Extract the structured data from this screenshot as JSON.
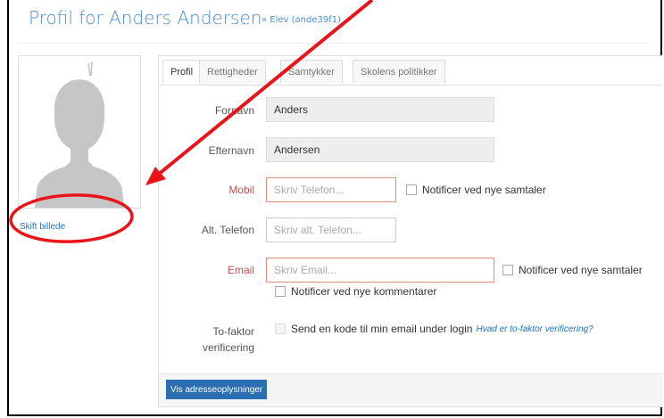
{
  "header": {
    "title": "Profil for Anders Andersen",
    "subtitle": "» Elev (ande39f1)"
  },
  "photo": {
    "change_label": "Skift billede"
  },
  "tabs": [
    {
      "label": "Profil",
      "active": true
    },
    {
      "label": "Rettigheder",
      "active": false
    },
    {
      "label": "Samtykker",
      "active": false
    },
    {
      "label": "Skolens politikker",
      "active": false
    }
  ],
  "form": {
    "first_name": {
      "label": "Fornavn",
      "value": "Anders"
    },
    "last_name": {
      "label": "Efternavn",
      "value": "Andersen"
    },
    "mobile": {
      "label": "Mobil",
      "placeholder": "Skriv Telefon...",
      "notify_label": "Notificer ved nye samtaler"
    },
    "alt_phone": {
      "label": "Alt. Telefon",
      "placeholder": "Skriv alt. Telefon..."
    },
    "email": {
      "label": "Email",
      "placeholder": "Skriv Email...",
      "notify_conversations_label": "Notificer ved nye samtaler",
      "notify_comments_label": "Notificer ved nye kommentarer"
    },
    "two_factor": {
      "label_line1": "To-faktor",
      "label_line2": "verificering",
      "option_label": "Send en kode til min email under login",
      "help_link": "Hvad er to-faktor verificering?"
    }
  },
  "footer": {
    "address_button": "Vis adresseoplysninger"
  },
  "annotation": {
    "color": "#e8141a"
  }
}
